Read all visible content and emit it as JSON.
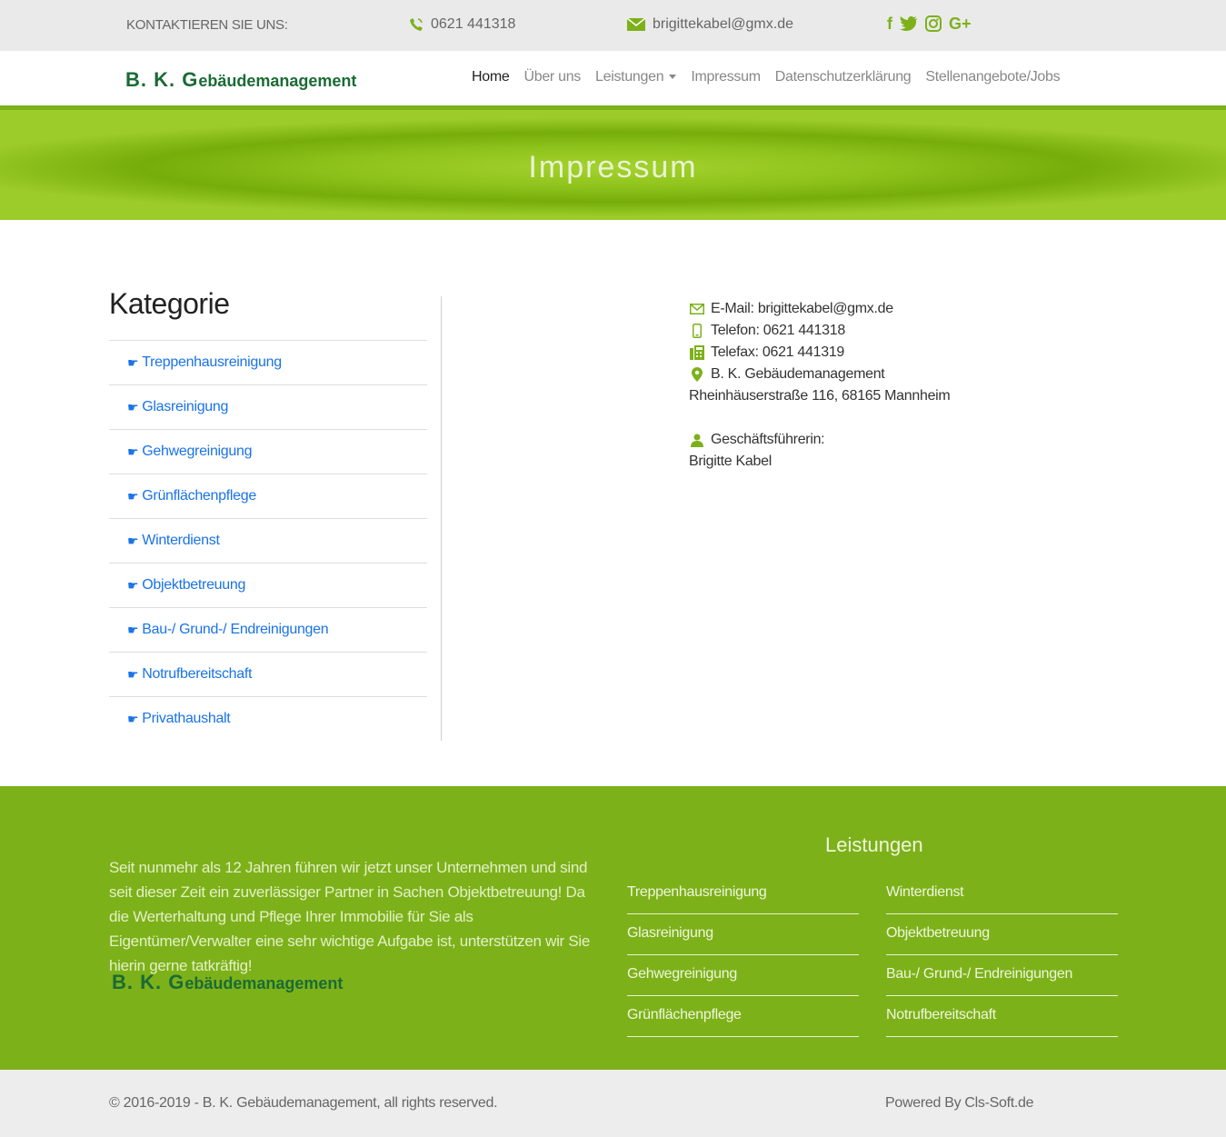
{
  "topbar": {
    "contact_label": "KONTAKTIEREN SIE UNS:",
    "phone": "0621 441318",
    "email": "brigittekabel@gmx.de",
    "socials": [
      "facebook-icon",
      "twitter-icon",
      "instagram-icon",
      "google-plus-icon"
    ]
  },
  "brand": {
    "initials": "B. K. ",
    "first_letter": "G",
    "rest": "ebäudemanagement"
  },
  "nav": {
    "items": [
      "Home",
      "Über uns",
      "Leistungen",
      "Impressum",
      "Datenschutzerklärung",
      "Stellenangebote/Jobs"
    ],
    "active": "Home"
  },
  "banner": {
    "title": "Impressum"
  },
  "category": {
    "title": "Kategorie",
    "items": [
      "Treppenhausreinigung",
      "Glasreinigung",
      "Gehwegreinigung",
      "Grünflächenpflege",
      "Winterdienst",
      "Objektbetreuung",
      "Bau-/ Grund-/ Endreinigungen",
      "Notrufbereitschaft",
      "Privathaushalt"
    ]
  },
  "info": {
    "email": "E-Mail: brigittekabel@gmx.de",
    "phone": "Telefon: 0621 441318",
    "fax": "Telefax: 0621 441319",
    "company": "B. K. Gebäudemanagement",
    "address": "Rheinhäuserstraße 116, 68165 Mannheim",
    "manager_label": "Geschäftsführerin:",
    "manager_name": "Brigitte Kabel"
  },
  "footer": {
    "about": "Seit nunmehr als 12 Jahren führen wir jetzt unser Unternehmen und sind seit dieser Zeit ein zuverlässiger Partner in Sachen Objektbetreuung! Da die Werterhaltung und Pflege Ihrer Immobilie für Sie als Eigentümer/Verwalter eine sehr wichtige Aufgabe ist, unterstützen wir Sie hierin gerne tatkräftig!",
    "services_title": "Leistungen",
    "col1": [
      "Treppenhausreinigung",
      "Glasreinigung",
      "Gehwegreinigung",
      "Grünflächenpflege"
    ],
    "col2": [
      "Winterdienst",
      "Objektbetreuung",
      "Bau-/ Grund-/ Endreinigungen",
      "Notrufbereitschaft"
    ]
  },
  "bottom": {
    "copyright": "© 2016-2019 - B. K. Gebäudemanagement, all rights reserved.",
    "powered": "Powered By Cls-Soft.de"
  },
  "colors": {
    "accent": "#7cb11a",
    "brand": "#1a6b35",
    "link": "#1a73e8"
  }
}
